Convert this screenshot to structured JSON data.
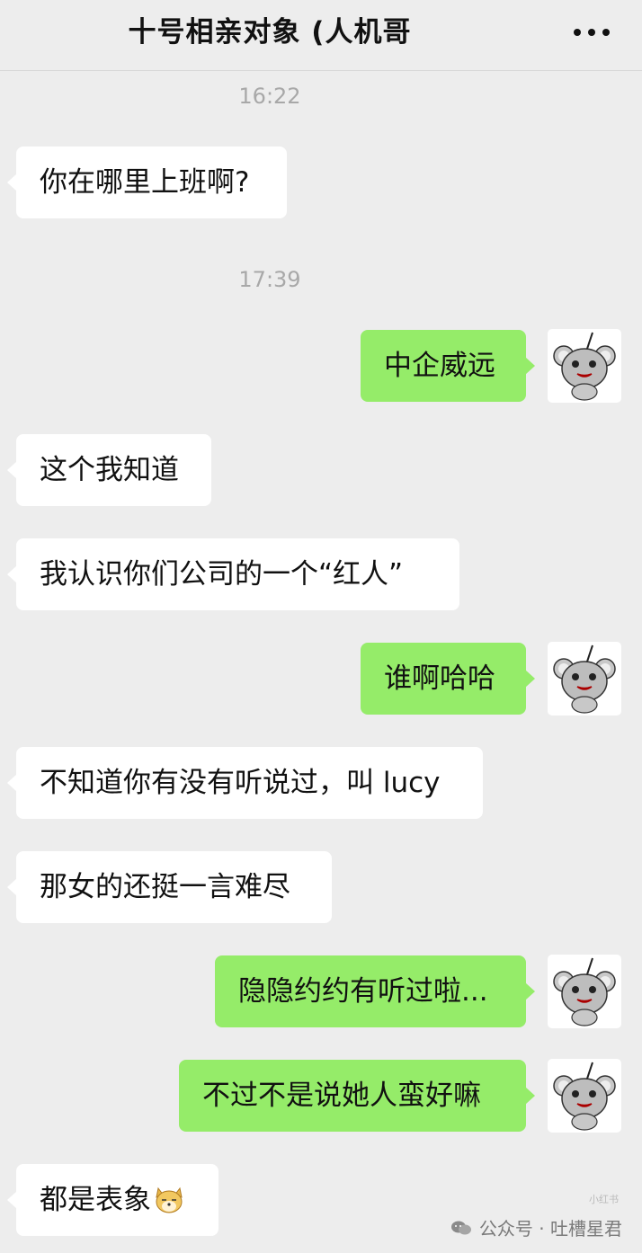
{
  "header": {
    "title": "十号相亲对象 (人机哥"
  },
  "timestamps": {
    "t1": "16:22",
    "t2": "17:39"
  },
  "messages": [
    {
      "side": "in",
      "text": "你在哪里上班啊?"
    },
    {
      "side": "out",
      "text": "中企威远"
    },
    {
      "side": "in",
      "text": "这个我知道"
    },
    {
      "side": "in",
      "text": "我认识你们公司的一个“红人”"
    },
    {
      "side": "out",
      "text": "谁啊哈哈"
    },
    {
      "side": "in",
      "text": "不知道你有没有听说过，叫 lucy"
    },
    {
      "side": "in",
      "text": "那女的还挺一言难尽"
    },
    {
      "side": "out",
      "text": "隐隐约约有听过啦..."
    },
    {
      "side": "out",
      "text": "不过不是说她人蛮好嘛"
    },
    {
      "side": "in",
      "text": "都是表象"
    }
  ],
  "watermark": {
    "text": "公众号 · 吐槽星君",
    "small": "小红书"
  },
  "colors": {
    "background": "#ededed",
    "incoming_bubble": "#ffffff",
    "outgoing_bubble": "#95ec69",
    "timestamp": "#a8a8a8"
  },
  "icons": {
    "more": "more-dots-icon",
    "avatar": "mouse-avatar-icon",
    "emoji": "doge-emoji-icon",
    "watermark": "wechat-official-account-icon"
  }
}
